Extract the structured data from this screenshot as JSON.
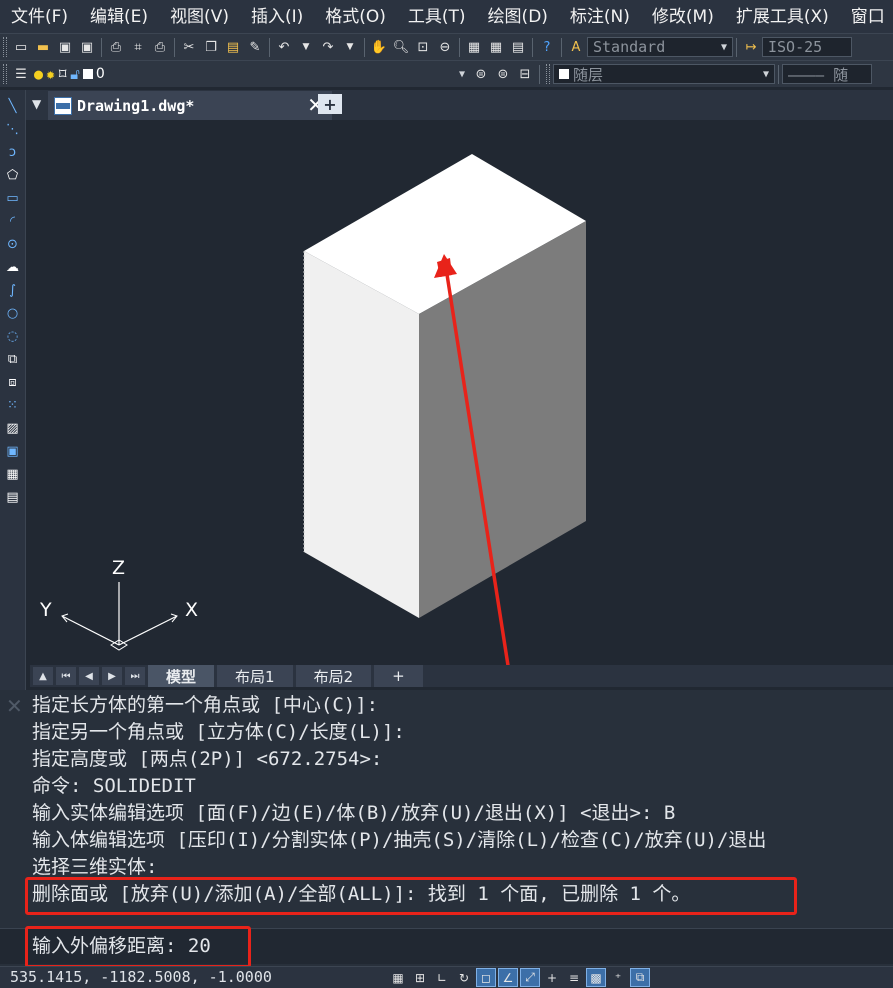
{
  "menu": [
    "文件(F)",
    "编辑(E)",
    "视图(V)",
    "插入(I)",
    "格式(O)",
    "工具(T)",
    "绘图(D)",
    "标注(N)",
    "修改(M)",
    "扩展工具(X)",
    "窗口"
  ],
  "toolbar1": {
    "text_style": "Standard",
    "dim_style": "ISO-25"
  },
  "toolbar2": {
    "layer_name": "0",
    "color": "随层",
    "linetype": "———— 随"
  },
  "doc_tab": {
    "title": "Drawing1.dwg*"
  },
  "viewport": {
    "ucs_z": "Z",
    "ucs_y": "Y",
    "ucs_x": "X",
    "colors": {
      "box_top": "#ffffff",
      "box_left": "#f0f0f0",
      "box_right": "#7c7c7c",
      "arrow": "#e8231a"
    }
  },
  "layout_tabs": [
    "模型",
    "布局1",
    "布局2",
    "+"
  ],
  "command_history": [
    "指定长方体的第一个角点或 [中心(C)]:",
    "指定另一个角点或 [立方体(C)/长度(L)]:",
    "指定高度或 [两点(2P)] <672.2754>:",
    "命令: SOLIDEDIT",
    "输入实体编辑选项 [面(F)/边(E)/体(B)/放弃(U)/退出(X)] <退出>: B",
    "输入体编辑选项 [压印(I)/分割实体(P)/抽壳(S)/清除(L)/检查(C)/放弃(U)/退出",
    "选择三维实体:",
    "删除面或 [放弃(U)/添加(A)/全部(ALL)]: 找到 1 个面, 已删除 1 个。"
  ],
  "command_input": "输入外偏移距离: 20",
  "status": {
    "coordinates": "535.1415, -1182.5008, -1.0000"
  },
  "highlight_color": "#e8231a"
}
